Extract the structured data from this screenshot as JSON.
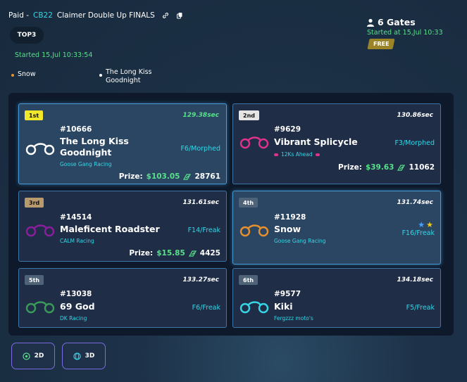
{
  "header": {
    "title_prefix": "Paid -",
    "title_code": "CB22",
    "title_rest": "Claimer Double Up FINALS",
    "top_badge": "TOP3",
    "started_left": "Started 15,Jul 10:33:54",
    "legend": [
      {
        "label": "Snow",
        "color": "#e8902e"
      },
      {
        "label": "The Long Kiss Goodnight",
        "color": "#ffffff"
      }
    ],
    "gates": "6 Gates",
    "started_right": "Started at 15,Jul 10:33",
    "free_badge": "FREE"
  },
  "results": [
    {
      "place": "1st",
      "badge_color": "#f2e82a",
      "time": "129.38sec",
      "time_color": "#58e08a",
      "id": "#10666",
      "name": "The Long Kiss Goodnight",
      "team": "Goose Gang Racing",
      "class": "F6/Morphed",
      "prize_label": "Prize:",
      "prize": "$103.05",
      "prize_points": "28761",
      "bike_color": "#ffffff",
      "highlight": true
    },
    {
      "place": "2nd",
      "badge_color": "#e5e5e5",
      "time": "130.86sec",
      "time_color": "#ffffff",
      "id": "#9629",
      "name": "Vibrant Splicycle",
      "team": "",
      "ahead": "12Ks Ahead",
      "class": "F3/Morphed",
      "prize_label": "Prize:",
      "prize": "$39.63",
      "prize_points": "11062",
      "bike_color": "#e0328a",
      "highlight": false
    },
    {
      "place": "3rd",
      "badge_color": "#b89a6c",
      "time": "131.61sec",
      "time_color": "#ffffff",
      "id": "#14514",
      "name": "Maleficent Roadster",
      "team": "CALM Racing",
      "class": "F14/Freak",
      "prize_label": "Prize:",
      "prize": "$15.85",
      "prize_points": "4425",
      "bike_color": "#8a1e9e",
      "highlight": false
    },
    {
      "place": "4th",
      "badge_color": "#4e6278",
      "time": "131.74sec",
      "time_color": "#ffffff",
      "id": "#11928",
      "name": "Snow",
      "team": "Goose Gang Racing",
      "class": "F16/Freak",
      "prize_label": "",
      "prize": "",
      "prize_points": "",
      "bike_color": "#e8902e",
      "highlight": true,
      "stars": [
        "#4aa0ff",
        "#f5c518"
      ]
    },
    {
      "place": "5th",
      "badge_color": "#4e6278",
      "time": "133.27sec",
      "time_color": "#ffffff",
      "id": "#13038",
      "name": "69 God",
      "team": "DK Racing",
      "class": "F6/Freak",
      "prize_label": "",
      "prize": "",
      "prize_points": "",
      "bike_color": "#3a9a5a",
      "highlight": false
    },
    {
      "place": "6th",
      "badge_color": "#4e6278",
      "time": "134.18sec",
      "time_color": "#ffffff",
      "id": "#9577",
      "name": "Kiki",
      "team": "Fergzzz moto's",
      "class": "F5/Freak",
      "prize_label": "",
      "prize": "",
      "prize_points": "",
      "bike_color": "#36d6e6",
      "highlight": false
    }
  ],
  "view_buttons": [
    {
      "label": "2D",
      "icon": "globe-2d-icon"
    },
    {
      "label": "3D",
      "icon": "globe-3d-icon"
    }
  ]
}
